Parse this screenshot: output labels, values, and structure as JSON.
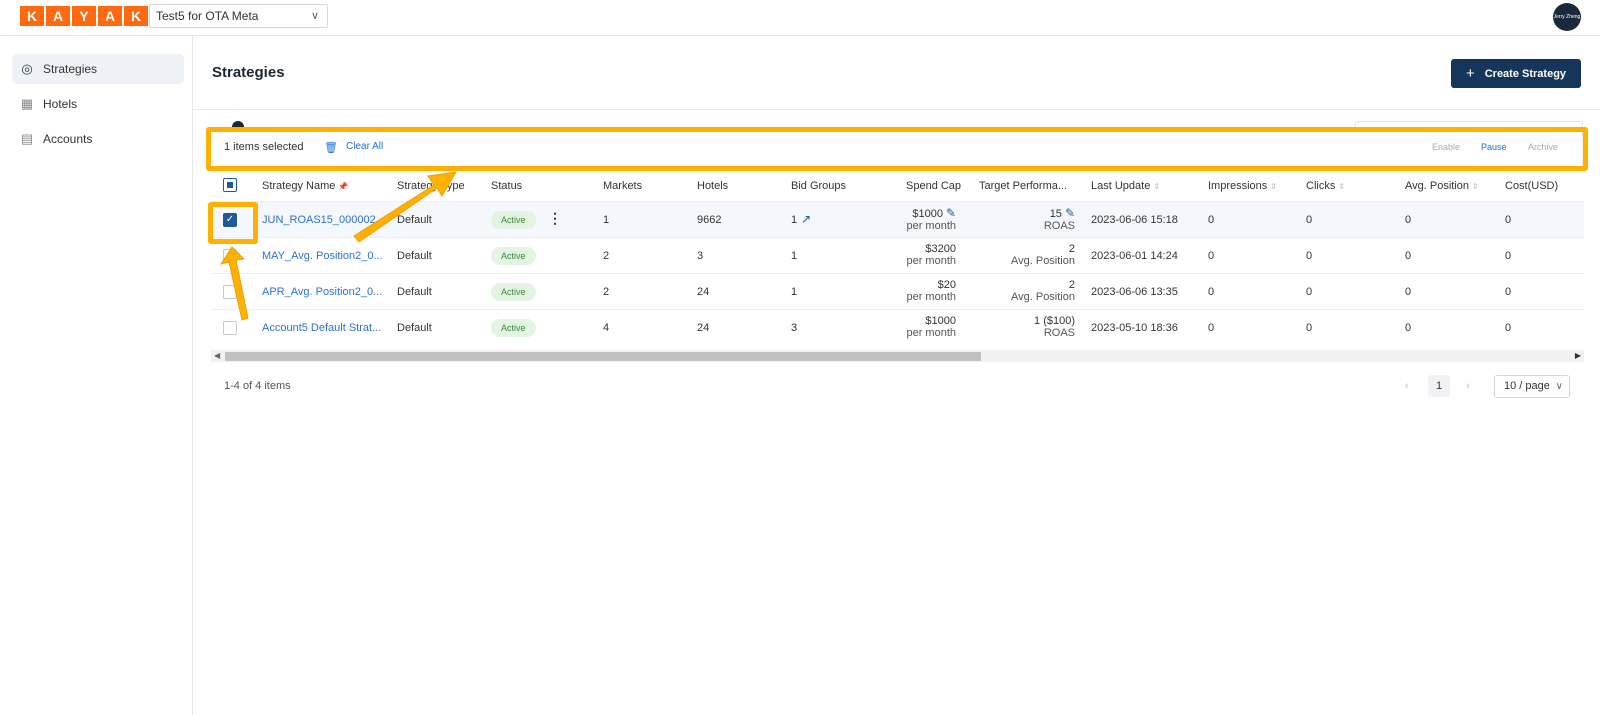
{
  "topbar": {
    "logo_letters": [
      "K",
      "A",
      "Y",
      "A",
      "K"
    ],
    "account_select": "Test5 for OTA Meta",
    "avatar_text": "Jerry Zheng"
  },
  "sidebar": {
    "items": [
      {
        "label": "Strategies",
        "icon": "target-icon",
        "active": true
      },
      {
        "label": "Hotels",
        "icon": "building-icon",
        "active": false
      },
      {
        "label": "Accounts",
        "icon": "ledger-icon",
        "active": false
      }
    ]
  },
  "page": {
    "title": "Strategies",
    "create_button": "Create Strategy"
  },
  "selection_bar": {
    "count_text": "1 items selected",
    "clear_all": "Clear All",
    "actions": {
      "enable": "Enable",
      "pause": "Pause",
      "archive": "Archive"
    }
  },
  "table": {
    "headers": {
      "strategy_name": "Strategy Name",
      "strategy_type": "Strategy Type",
      "status": "Status",
      "markets": "Markets",
      "hotels": "Hotels",
      "bid_groups": "Bid Groups",
      "spend_cap": "Spend Cap",
      "target_performance": "Target Performa...",
      "last_update": "Last Update",
      "impressions": "Impressions",
      "clicks": "Clicks",
      "avg_position": "Avg. Position",
      "cost": "Cost(USD)"
    },
    "rows": [
      {
        "checked": true,
        "name": "JUN_ROAS15_000002",
        "type": "Default",
        "status": "Active",
        "markets": "1",
        "hotels": "9662",
        "bid_groups": "1",
        "spend_cap": "$1000",
        "spend_cap_period": "per month",
        "target": "15",
        "target_unit": "ROAS",
        "last_update": "2023-06-06 15:18",
        "impressions": "0",
        "clicks": "0",
        "avg_position": "0",
        "cost": "0"
      },
      {
        "checked": false,
        "name": "MAY_Avg. Position2_0...",
        "type": "Default",
        "status": "Active",
        "markets": "2",
        "hotels": "3",
        "bid_groups": "1",
        "spend_cap": "$3200",
        "spend_cap_period": "per month",
        "target": "2",
        "target_unit": "Avg. Position",
        "last_update": "2023-06-01 14:24",
        "impressions": "0",
        "clicks": "0",
        "avg_position": "0",
        "cost": "0"
      },
      {
        "checked": false,
        "name": "APR_Avg. Position2_0...",
        "type": "Default",
        "status": "Active",
        "markets": "2",
        "hotels": "24",
        "bid_groups": "1",
        "spend_cap": "$20",
        "spend_cap_period": "per month",
        "target": "2",
        "target_unit": "Avg. Position",
        "last_update": "2023-06-06 13:35",
        "impressions": "0",
        "clicks": "0",
        "avg_position": "0",
        "cost": "0"
      },
      {
        "checked": false,
        "name": "Account5 Default Strat...",
        "type": "Default",
        "status": "Active",
        "markets": "4",
        "hotels": "24",
        "bid_groups": "3",
        "spend_cap": "$1000",
        "spend_cap_period": "per month",
        "target": "1 ($100)",
        "target_unit": "ROAS",
        "last_update": "2023-05-10 18:36",
        "impressions": "0",
        "clicks": "0",
        "avg_position": "0",
        "cost": "0"
      }
    ]
  },
  "pagination": {
    "range_text": "1-4 of 4 items",
    "current_page": "1",
    "page_size": "10 / page"
  },
  "colors": {
    "brand": "#ff690f",
    "primary_button": "#15365a",
    "highlight": "#ffb000",
    "link": "#2f6fcf"
  }
}
